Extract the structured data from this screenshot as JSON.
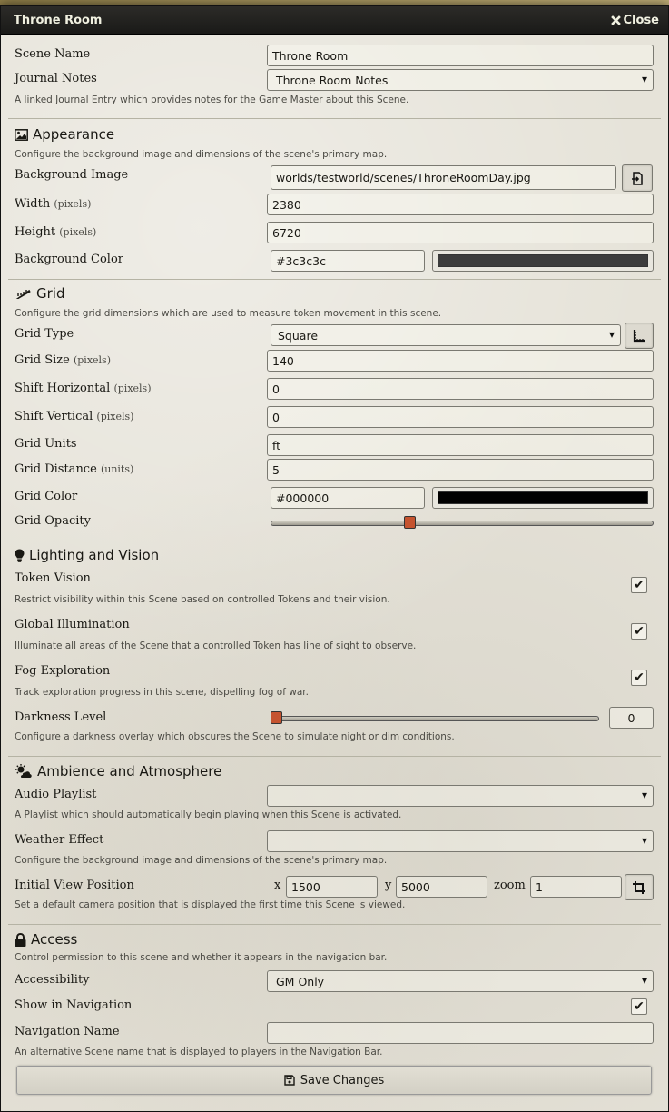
{
  "window": {
    "title": "Throne Room",
    "close_label": "Close"
  },
  "basics": {
    "scene_name_label": "Scene Name",
    "scene_name_value": "Throne Room",
    "journal_label": "Journal Notes",
    "journal_value": "Throne Room Notes",
    "journal_hint": "A linked Journal Entry which provides notes for the Game Master about this Scene."
  },
  "appearance": {
    "title": "Appearance",
    "hint": "Configure the background image and dimensions of the scene's primary map.",
    "bg_image_label": "Background Image",
    "bg_image_value": "worlds/testworld/scenes/ThroneRoomDay.jpg",
    "width_label": "Width",
    "width_unit": "(pixels)",
    "width_value": "2380",
    "height_label": "Height",
    "height_unit": "(pixels)",
    "height_value": "6720",
    "bg_color_label": "Background Color",
    "bg_color_value": "#3c3c3c",
    "bg_color_swatch": "#3c3c3c"
  },
  "grid": {
    "title": "Grid",
    "hint": "Configure the grid dimensions which are used to measure token movement in this scene.",
    "type_label": "Grid Type",
    "type_value": "Square",
    "size_label": "Grid Size",
    "size_unit": "(pixels)",
    "size_value": "140",
    "shift_h_label": "Shift Horizontal",
    "shift_h_unit": "(pixels)",
    "shift_h_value": "0",
    "shift_v_label": "Shift Vertical",
    "shift_v_unit": "(pixels)",
    "shift_v_value": "0",
    "units_label": "Grid Units",
    "units_value": "ft",
    "distance_label": "Grid Distance",
    "distance_unit": "(units)",
    "distance_value": "5",
    "color_label": "Grid Color",
    "color_value": "#000000",
    "color_swatch": "#000000",
    "opacity_label": "Grid Opacity",
    "opacity_fraction": 0.36
  },
  "lighting": {
    "title": "Lighting and Vision",
    "token_vision_label": "Token Vision",
    "token_vision_hint": "Restrict visibility within this Scene based on controlled Tokens and their vision.",
    "global_illum_label": "Global Illumination",
    "global_illum_hint": "Illuminate all areas of the Scene that a controlled Token has line of sight to observe.",
    "fog_label": "Fog Exploration",
    "fog_hint": "Track exploration progress in this scene, dispelling fog of war.",
    "darkness_label": "Darkness Level",
    "darkness_value": "0",
    "darkness_hint": "Configure a darkness overlay which obscures the Scene to simulate night or dim conditions.",
    "check_mark": "✔"
  },
  "ambience": {
    "title": "Ambience and Atmosphere",
    "playlist_label": "Audio Playlist",
    "playlist_value": "",
    "playlist_hint": "A Playlist which should automatically begin playing when this Scene is activated.",
    "weather_label": "Weather Effect",
    "weather_value": "",
    "weather_hint": "Configure the background image and dimensions of the scene's primary map.",
    "view_label": "Initial View Position",
    "x_label": "x",
    "x_value": "1500",
    "y_label": "y",
    "y_value": "5000",
    "zoom_label": "zoom",
    "zoom_value": "1",
    "view_hint": "Set a default camera position that is displayed the first time this Scene is viewed."
  },
  "access": {
    "title": "Access",
    "hint": "Control permission to this scene and whether it appears in the navigation bar.",
    "accessibility_label": "Accessibility",
    "accessibility_value": "GM Only",
    "nav_label": "Show in Navigation",
    "nav_name_label": "Navigation Name",
    "nav_name_value": "",
    "nav_name_hint": "An alternative Scene name that is displayed to players in the Navigation Bar."
  },
  "footer": {
    "save_label": "Save Changes"
  }
}
